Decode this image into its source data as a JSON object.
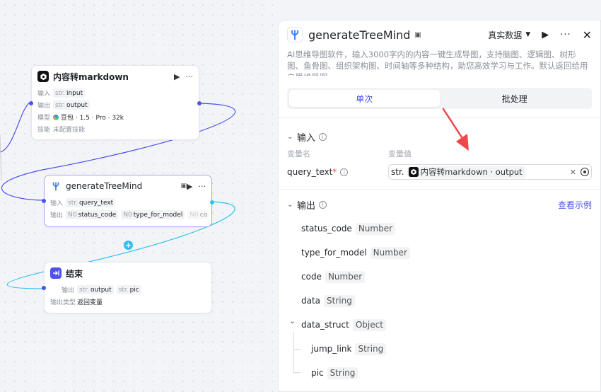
{
  "canvas": {
    "nodes": {
      "markdown": {
        "title": "内容转markdown",
        "input_label": "输入",
        "input_type": "str.",
        "input_value": "input",
        "output_label": "输出",
        "output_type": "str.",
        "output_value": "output",
        "model_label": "模型",
        "model_value": "豆包 · 1.5 · Pro · 32k",
        "skill_label": "技能",
        "skill_value": "未配置技能"
      },
      "tree": {
        "title": "generateTreeMind",
        "input_label": "输入",
        "input_type": "str.",
        "input_value": "query_text",
        "output_label": "输出",
        "outputs": [
          {
            "type": "N0",
            "name": "status_code"
          },
          {
            "type": "N0",
            "name": "type_for_model"
          },
          {
            "type": "N0",
            "name": "co"
          }
        ]
      },
      "end": {
        "title": "结束",
        "output_label": "输出",
        "outputs": [
          {
            "type": "str.",
            "name": "output"
          },
          {
            "type": "str.",
            "name": "pic"
          }
        ],
        "output_type_label": "输出类型",
        "output_type_value": "返回变量"
      }
    },
    "add_glyph": "+",
    "more_glyph": "···",
    "run_glyph": "▶",
    "colors": {
      "port": "#4d53e8",
      "edge": "#4d53e8",
      "edge_selected": "#2dc1f0"
    }
  },
  "panel": {
    "title": "generateTreeMind",
    "data_mode": "真实数据",
    "description": "AI思维导图软件，输入3000字内的内容一键生成导图，支持脑图、逻辑图、树形图、鱼骨图、组织架构图、时间轴等多种结构，助您高效学习与工作。默认返回给用户思维导图",
    "tabs": [
      {
        "label": "单次",
        "active": true
      },
      {
        "label": "批处理",
        "active": false
      }
    ],
    "input": {
      "section_title": "输入",
      "col_name": "变量名",
      "col_value": "变量值",
      "var_name": "query_text",
      "required_mark": "*",
      "value_type": "str.",
      "value_ref": "内容转markdown · output"
    },
    "output": {
      "section_title": "输出",
      "example_link": "查看示例",
      "fields": [
        {
          "name": "status_code",
          "type": "Number"
        },
        {
          "name": "type_for_model",
          "type": "Number"
        },
        {
          "name": "code",
          "type": "Number"
        },
        {
          "name": "data",
          "type": "String"
        },
        {
          "name": "data_struct",
          "type": "Object"
        },
        {
          "name": "jump_link",
          "type": "String"
        },
        {
          "name": "pic",
          "type": "String"
        }
      ]
    },
    "colors": {
      "accent": "#4d53e8",
      "required": "#f54a45",
      "arrow": "#f0474a"
    }
  }
}
